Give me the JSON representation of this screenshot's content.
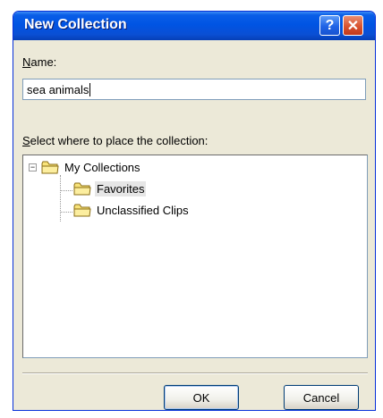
{
  "window": {
    "title": "New Collection",
    "help_glyph": "?",
    "close_glyph": "✕"
  },
  "form": {
    "name_label_accel": "N",
    "name_label_rest": "ame:",
    "name_value": "sea animals",
    "place_label_accel": "S",
    "place_label_rest": "elect where to place the collection:"
  },
  "tree": {
    "root": {
      "label": "My Collections",
      "expanded": true,
      "expander": "−"
    },
    "children": [
      {
        "label": "Favorites",
        "selected": true
      },
      {
        "label": "Unclassified Clips",
        "selected": false
      }
    ]
  },
  "buttons": {
    "ok_label": "OK",
    "cancel_label": "Cancel"
  },
  "colors": {
    "titlebar": "#0054e3",
    "dialog_bg": "#ece9d8",
    "close_red": "#d9532f",
    "folder_yellow": "#f8e37a"
  },
  "icons": [
    "help-icon",
    "close-icon",
    "folder-icon",
    "collapse-icon"
  ]
}
